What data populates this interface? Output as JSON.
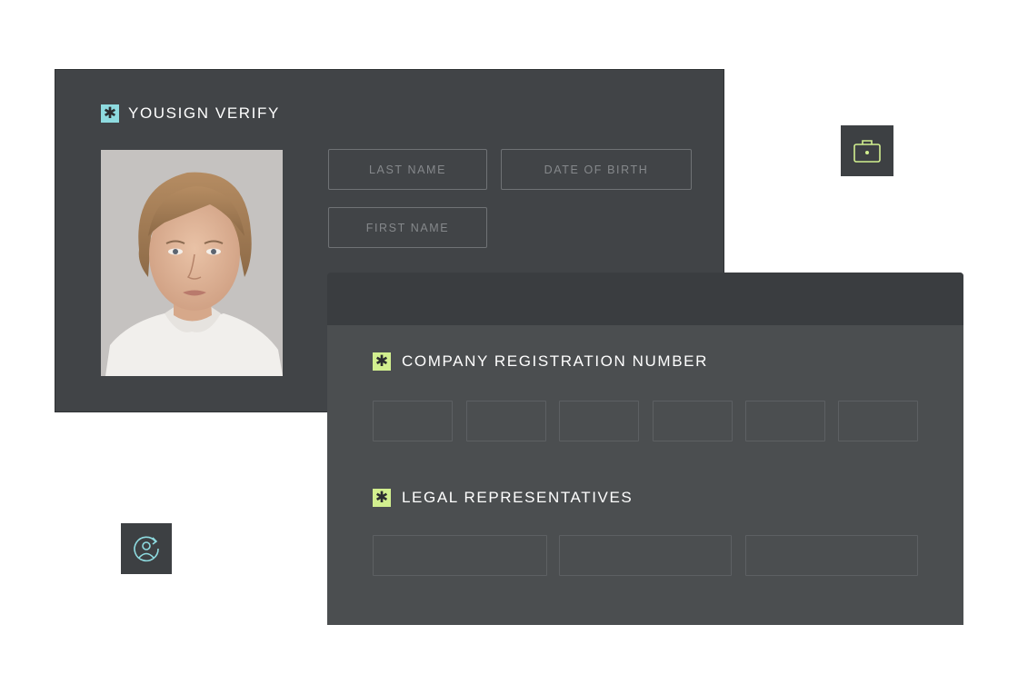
{
  "id_card": {
    "title": "YOUSIGN VERIFY",
    "title_icon": "asterisk-icon",
    "photo": "portrait-photo",
    "fields": {
      "last_name": "LAST NAME",
      "date_of_birth": "DATE OF BIRTH",
      "first_name": "FIRST NAME"
    }
  },
  "company_panel": {
    "sections": [
      {
        "title": "COMPANY REGISTRATION NUMBER",
        "icon": "asterisk-icon",
        "box_count": 6
      },
      {
        "title": "LEGAL REPRESENTATIVES",
        "icon": "asterisk-icon",
        "box_count": 3
      }
    ]
  },
  "floating_icons": {
    "briefcase": "briefcase-icon",
    "user_refresh": "user-refresh-icon"
  },
  "colors": {
    "card_bg": "#414447",
    "panel_bg": "#4b4e50",
    "accent_cyan": "#8edbe0",
    "accent_lime": "#d2ef8f"
  }
}
